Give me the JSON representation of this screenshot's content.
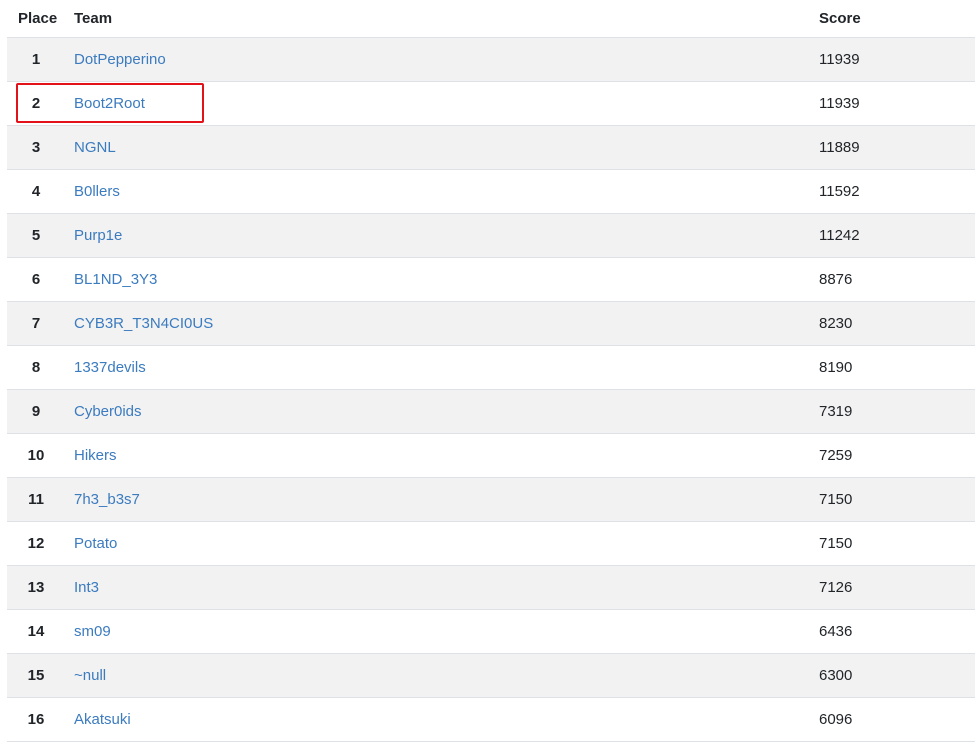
{
  "headers": {
    "place": "Place",
    "team": "Team",
    "score": "Score"
  },
  "standings": [
    {
      "place": "1",
      "team": "DotPepperino",
      "score": "11939"
    },
    {
      "place": "2",
      "team": "Boot2Root",
      "score": "11939"
    },
    {
      "place": "3",
      "team": "NGNL",
      "score": "11889"
    },
    {
      "place": "4",
      "team": "B0llers",
      "score": "11592"
    },
    {
      "place": "5",
      "team": "Purp1e",
      "score": "11242"
    },
    {
      "place": "6",
      "team": "BL1ND_3Y3",
      "score": "8876"
    },
    {
      "place": "7",
      "team": "CYB3R_T3N4CI0US",
      "score": "8230"
    },
    {
      "place": "8",
      "team": "1337devils",
      "score": "8190"
    },
    {
      "place": "9",
      "team": "Cyber0ids",
      "score": "7319"
    },
    {
      "place": "10",
      "team": "Hikers",
      "score": "7259"
    },
    {
      "place": "11",
      "team": "7h3_b3s7",
      "score": "7150"
    },
    {
      "place": "12",
      "team": "Potato",
      "score": "7150"
    },
    {
      "place": "13",
      "team": "Int3",
      "score": "7126"
    },
    {
      "place": "14",
      "team": "sm09",
      "score": "6436"
    },
    {
      "place": "15",
      "team": "~null",
      "score": "6300"
    },
    {
      "place": "16",
      "team": "Akatsuki",
      "score": "6096"
    }
  ],
  "colors": {
    "link": "#3b7bbf",
    "stripe": "#f2f2f2",
    "highlight": "#e3121a"
  }
}
